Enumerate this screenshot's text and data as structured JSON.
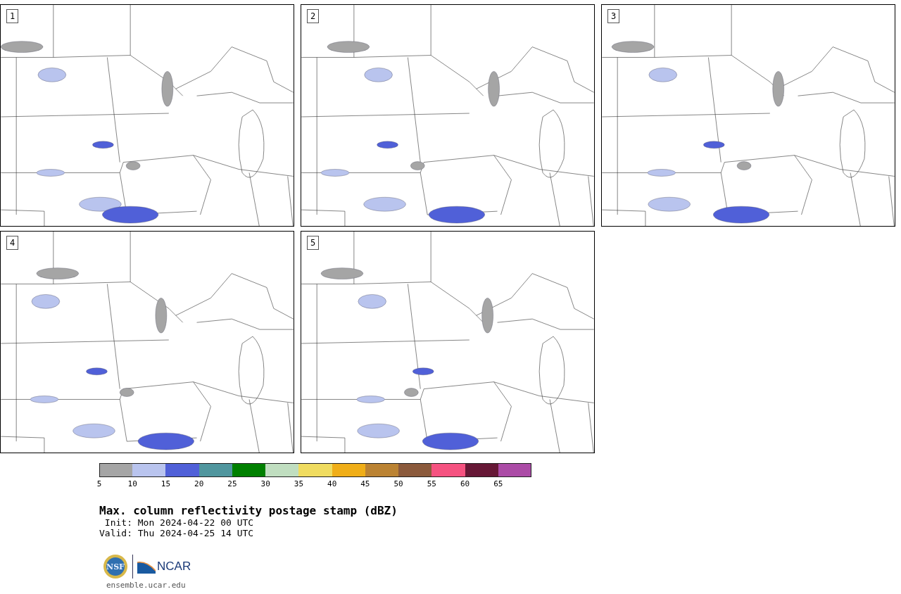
{
  "panels": [
    {
      "number": "1"
    },
    {
      "number": "2"
    },
    {
      "number": "3"
    },
    {
      "number": "4"
    },
    {
      "number": "5"
    }
  ],
  "colorbar": {
    "bins": [
      {
        "color": "#a5a5a5",
        "tick": "5"
      },
      {
        "color": "#b9c4ee",
        "tick": "10"
      },
      {
        "color": "#5060d8",
        "tick": "15"
      },
      {
        "color": "#50969e",
        "tick": "20"
      },
      {
        "color": "#008000",
        "tick": "25"
      },
      {
        "color": "#c0dec0",
        "tick": "30"
      },
      {
        "color": "#f0dc60",
        "tick": "35"
      },
      {
        "color": "#f0ae18",
        "tick": "40"
      },
      {
        "color": "#bb8333",
        "tick": "45"
      },
      {
        "color": "#8b5a3c",
        "tick": "50"
      },
      {
        "color": "#f55280",
        "tick": "55"
      },
      {
        "color": "#661836",
        "tick": "60"
      },
      {
        "color": "#ab4ba6",
        "tick": "65"
      }
    ]
  },
  "title": "Max. column reflectivity postage stamp (dBZ)",
  "init": " Init: Mon 2024-04-22 00 UTC",
  "valid": "Valid: Thu 2024-04-25 14 UTC",
  "logos": {
    "nsf": "NSF",
    "ncar": "NCAR"
  },
  "url": "ensemble.ucar.edu"
}
